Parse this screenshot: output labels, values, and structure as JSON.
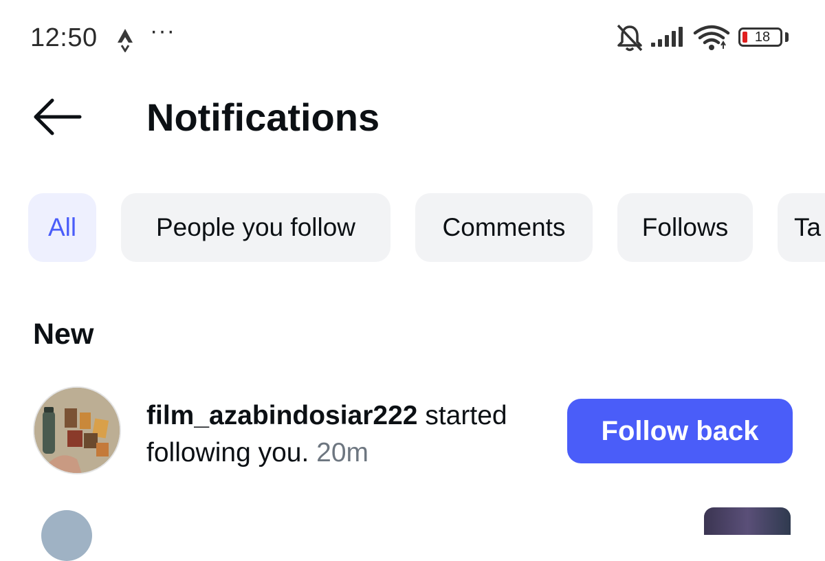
{
  "status_bar": {
    "time": "12:50",
    "more": "···",
    "battery_level": "18",
    "icons": [
      "activity-icon",
      "mute-icon",
      "signal-icon",
      "wifi-icon",
      "battery-icon"
    ]
  },
  "header": {
    "back_icon": "back-arrow-icon",
    "title": "Notifications"
  },
  "filters": [
    {
      "label": "All",
      "active": true
    },
    {
      "label": "People you follow",
      "active": false
    },
    {
      "label": "Comments",
      "active": false
    },
    {
      "label": "Follows",
      "active": false
    },
    {
      "label": "Ta",
      "active": false
    }
  ],
  "sections": {
    "new_heading": "New"
  },
  "notifications": [
    {
      "username": "film_azabindosiar222",
      "action": "started following you.",
      "time": "20m",
      "button_label": "Follow back"
    }
  ],
  "colors": {
    "accent": "#4a5df9",
    "active_chip_bg": "#eef0fe",
    "chip_bg": "#f2f3f5",
    "text": "#0c1014",
    "muted_text": "#6d7680",
    "battery_low": "#e02020"
  }
}
